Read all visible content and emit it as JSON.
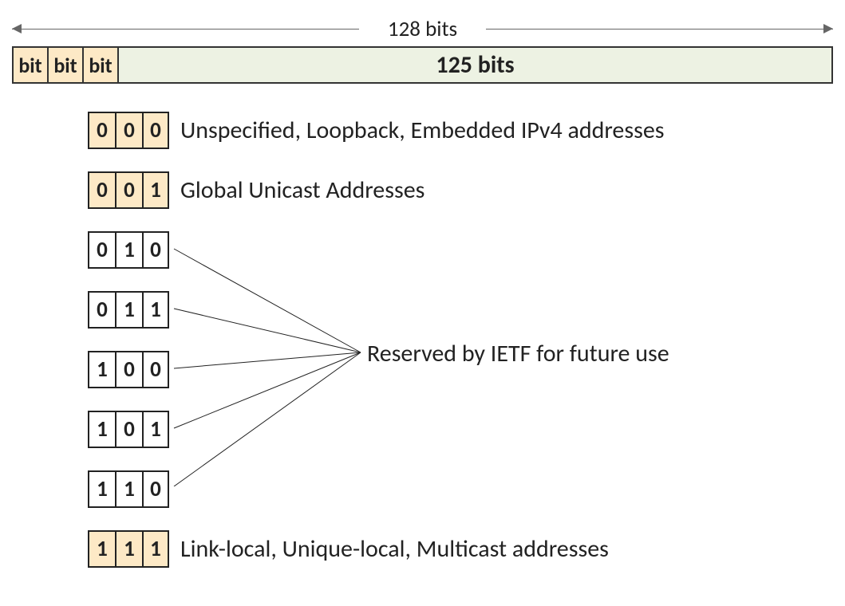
{
  "top_label": "128 bits",
  "bar": {
    "bit_label": "bit",
    "rest_label": "125 bits"
  },
  "rows": [
    {
      "bits": [
        "0",
        "0",
        "0"
      ],
      "style": "yellow",
      "desc": "Unspecified, Loopback, Embedded IPv4 addresses"
    },
    {
      "bits": [
        "0",
        "0",
        "1"
      ],
      "style": "yellow",
      "desc": "Global Unicast Addresses"
    },
    {
      "bits": [
        "0",
        "1",
        "0"
      ],
      "style": "white",
      "desc": ""
    },
    {
      "bits": [
        "0",
        "1",
        "1"
      ],
      "style": "white",
      "desc": ""
    },
    {
      "bits": [
        "1",
        "0",
        "0"
      ],
      "style": "white",
      "desc": ""
    },
    {
      "bits": [
        "1",
        "0",
        "1"
      ],
      "style": "white",
      "desc": ""
    },
    {
      "bits": [
        "1",
        "1",
        "0"
      ],
      "style": "white",
      "desc": ""
    },
    {
      "bits": [
        "1",
        "1",
        "1"
      ],
      "style": "yellow",
      "desc": "Link-local, Unique-local, Multicast addresses"
    }
  ],
  "reserved_label": "Reserved by IETF for future use"
}
